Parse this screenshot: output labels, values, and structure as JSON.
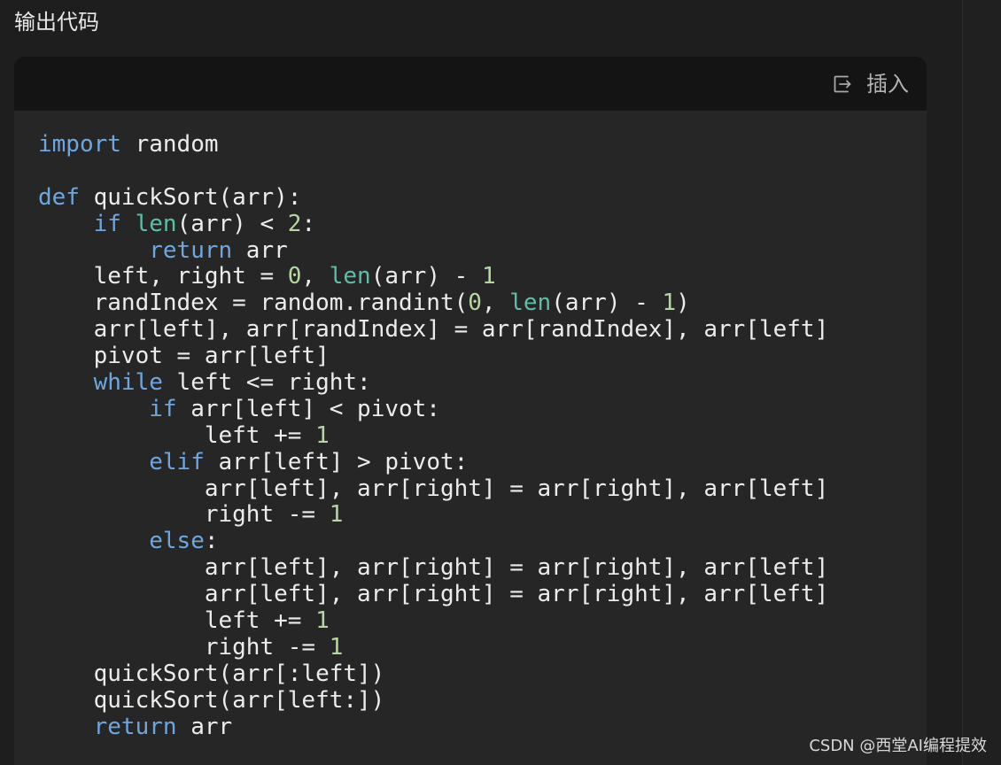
{
  "section_title": "输出代码",
  "toolbar": {
    "insert_label": "插入",
    "insert_icon": "insert-icon"
  },
  "code": {
    "language": "python",
    "lines": [
      [
        {
          "t": "kw",
          "s": "import"
        },
        {
          "t": "plain",
          "s": " random"
        }
      ],
      [],
      [
        {
          "t": "kw",
          "s": "def"
        },
        {
          "t": "plain",
          "s": " quickSort(arr):"
        }
      ],
      [
        {
          "t": "plain",
          "s": "    "
        },
        {
          "t": "kw",
          "s": "if"
        },
        {
          "t": "plain",
          "s": " "
        },
        {
          "t": "bi",
          "s": "len"
        },
        {
          "t": "plain",
          "s": "(arr) < "
        },
        {
          "t": "num",
          "s": "2"
        },
        {
          "t": "plain",
          "s": ":"
        }
      ],
      [
        {
          "t": "plain",
          "s": "        "
        },
        {
          "t": "kw",
          "s": "return"
        },
        {
          "t": "plain",
          "s": " arr"
        }
      ],
      [
        {
          "t": "plain",
          "s": "    left, right = "
        },
        {
          "t": "num",
          "s": "0"
        },
        {
          "t": "plain",
          "s": ", "
        },
        {
          "t": "bi",
          "s": "len"
        },
        {
          "t": "plain",
          "s": "(arr) - "
        },
        {
          "t": "num",
          "s": "1"
        }
      ],
      [
        {
          "t": "plain",
          "s": "    randIndex = random.randint("
        },
        {
          "t": "num",
          "s": "0"
        },
        {
          "t": "plain",
          "s": ", "
        },
        {
          "t": "bi",
          "s": "len"
        },
        {
          "t": "plain",
          "s": "(arr) - "
        },
        {
          "t": "num",
          "s": "1"
        },
        {
          "t": "plain",
          "s": ")"
        }
      ],
      [
        {
          "t": "plain",
          "s": "    arr[left], arr[randIndex] = arr[randIndex], arr[left]"
        }
      ],
      [
        {
          "t": "plain",
          "s": "    pivot = arr[left]"
        }
      ],
      [
        {
          "t": "plain",
          "s": "    "
        },
        {
          "t": "kw",
          "s": "while"
        },
        {
          "t": "plain",
          "s": " left <= right:"
        }
      ],
      [
        {
          "t": "plain",
          "s": "        "
        },
        {
          "t": "kw",
          "s": "if"
        },
        {
          "t": "plain",
          "s": " arr[left] < pivot:"
        }
      ],
      [
        {
          "t": "plain",
          "s": "            left += "
        },
        {
          "t": "num",
          "s": "1"
        }
      ],
      [
        {
          "t": "plain",
          "s": "        "
        },
        {
          "t": "kw",
          "s": "elif"
        },
        {
          "t": "plain",
          "s": " arr[left] > pivot:"
        }
      ],
      [
        {
          "t": "plain",
          "s": "            arr[left], arr[right] = arr[right], arr[left]"
        }
      ],
      [
        {
          "t": "plain",
          "s": "            right -= "
        },
        {
          "t": "num",
          "s": "1"
        }
      ],
      [
        {
          "t": "plain",
          "s": "        "
        },
        {
          "t": "kw",
          "s": "else"
        },
        {
          "t": "plain",
          "s": ":"
        }
      ],
      [
        {
          "t": "plain",
          "s": "            arr[left], arr[right] = arr[right], arr[left]"
        }
      ],
      [
        {
          "t": "plain",
          "s": "            arr[left], arr[right] = arr[right], arr[left]"
        }
      ],
      [
        {
          "t": "plain",
          "s": "            left += "
        },
        {
          "t": "num",
          "s": "1"
        }
      ],
      [
        {
          "t": "plain",
          "s": "            right -= "
        },
        {
          "t": "num",
          "s": "1"
        }
      ],
      [
        {
          "t": "plain",
          "s": "    quickSort(arr[:left])"
        }
      ],
      [
        {
          "t": "plain",
          "s": "    quickSort(arr[left:])"
        }
      ],
      [
        {
          "t": "plain",
          "s": "    "
        },
        {
          "t": "kw",
          "s": "return"
        },
        {
          "t": "plain",
          "s": " arr"
        }
      ]
    ]
  },
  "watermark": "CSDN @西堂AI编程提效",
  "colors": {
    "background": "#1e1e1e",
    "toolbar": "#141414",
    "code_background": "#262626",
    "keyword": "#6ea7e0",
    "builtin": "#5cc0a8",
    "number": "#b5d7a0",
    "text": "#ececec"
  }
}
